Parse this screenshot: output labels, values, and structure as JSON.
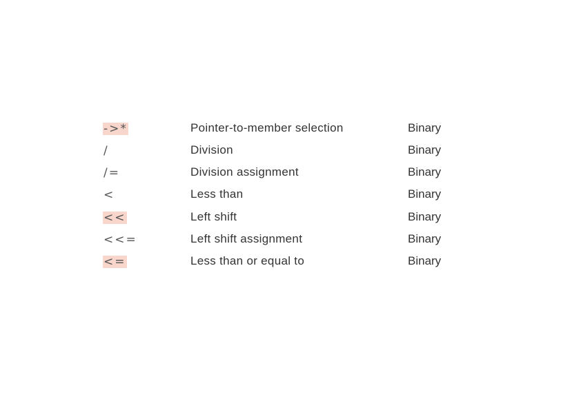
{
  "rows": [
    {
      "operator": "->*",
      "description": "Pointer-to-member selection",
      "type": "Binary",
      "highlighted": true
    },
    {
      "operator": "/",
      "description": "Division",
      "type": "Binary",
      "highlighted": false
    },
    {
      "operator": "/=",
      "description": "Division assignment",
      "type": "Binary",
      "highlighted": false
    },
    {
      "operator": "<",
      "description": "Less than",
      "type": "Binary",
      "highlighted": false
    },
    {
      "operator": "<<",
      "description": "Left shift",
      "type": "Binary",
      "highlighted": true
    },
    {
      "operator": "<<=",
      "description": "Left shift assignment",
      "type": "Binary",
      "highlighted": false
    },
    {
      "operator": "<=",
      "description": "Less than or equal to",
      "type": "Binary",
      "highlighted": true
    }
  ],
  "highlight_color": "#f8d6cb"
}
